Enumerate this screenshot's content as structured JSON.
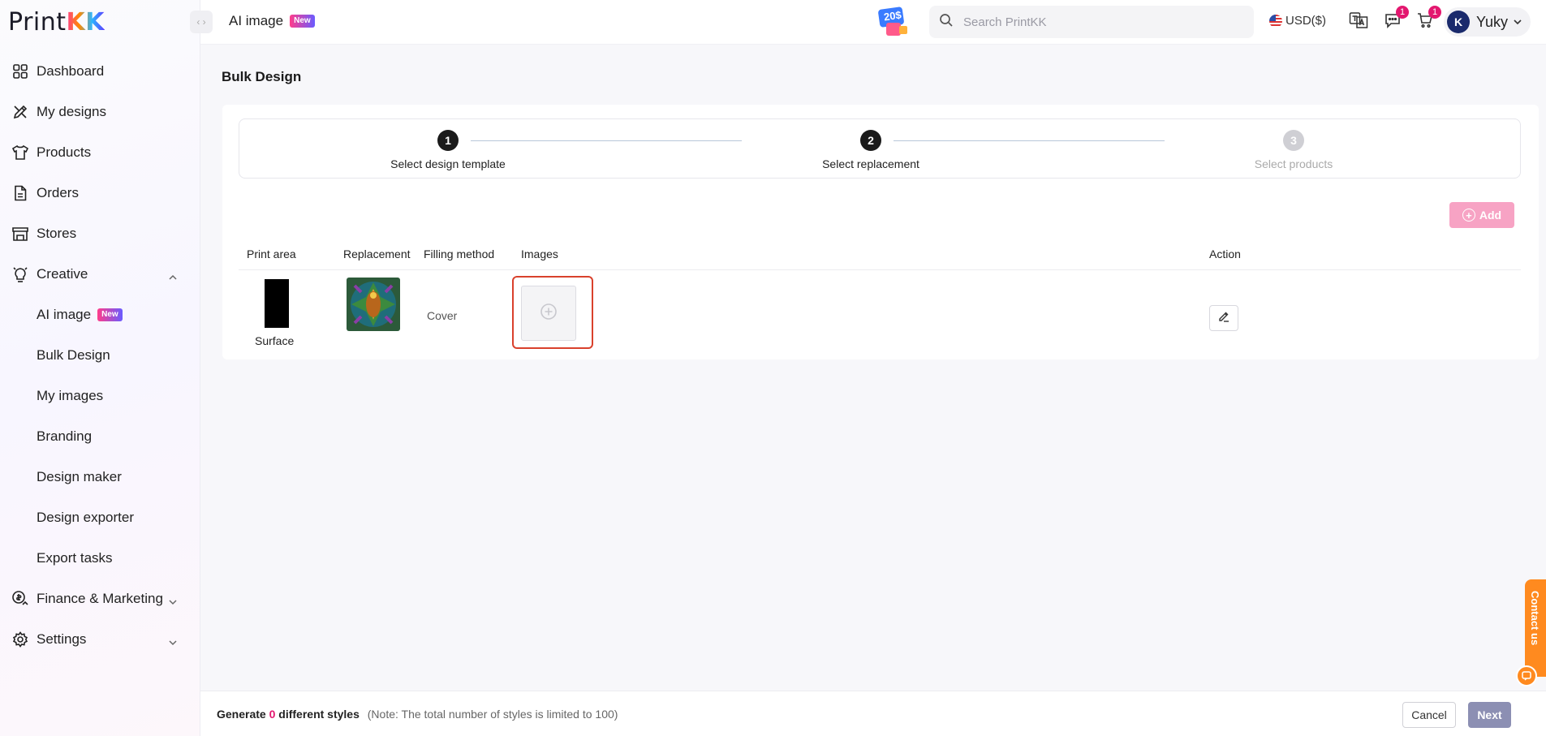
{
  "brand": {
    "name_part1": "Print",
    "name_part2": "KK"
  },
  "topbar": {
    "page_tab": "AI image",
    "new_badge": "New",
    "promo_text": "20$",
    "search_placeholder": "Search PrintKK",
    "currency": "USD($)",
    "messages_count": "1",
    "cart_count": "1",
    "user_initial": "K",
    "user_name": "Yuky"
  },
  "sidebar": {
    "items": [
      {
        "label": "Dashboard",
        "icon": "dashboard-icon"
      },
      {
        "label": "My designs",
        "icon": "designs-icon"
      },
      {
        "label": "Products",
        "icon": "tshirt-icon"
      },
      {
        "label": "Orders",
        "icon": "document-icon"
      },
      {
        "label": "Stores",
        "icon": "store-icon"
      },
      {
        "label": "Creative",
        "icon": "bulb-icon"
      }
    ],
    "creative_sub": [
      {
        "label": "AI image",
        "badge": "New"
      },
      {
        "label": "Bulk Design"
      },
      {
        "label": "My images"
      },
      {
        "label": "Branding"
      },
      {
        "label": "Design maker"
      },
      {
        "label": "Design exporter"
      },
      {
        "label": "Export tasks"
      }
    ],
    "bottom": [
      {
        "label": "Finance & Marketing",
        "icon": "finance-icon"
      },
      {
        "label": "Settings",
        "icon": "gear-icon"
      }
    ]
  },
  "main": {
    "title": "Bulk Design",
    "steps": [
      {
        "num": "1",
        "label": "Select design template"
      },
      {
        "num": "2",
        "label": "Select replacement"
      },
      {
        "num": "3",
        "label": "Select products"
      }
    ],
    "add_label": "Add",
    "table": {
      "headers": [
        "Print area",
        "Replacement",
        "Filling method",
        "Images",
        "Action"
      ],
      "rows": [
        {
          "print_area": "Surface",
          "filling_method": "Cover"
        }
      ]
    }
  },
  "footer": {
    "generate_prefix": "Generate",
    "count": "0",
    "generate_suffix": "different styles",
    "note": "(Note: The total number of styles is limited to 100)",
    "cancel": "Cancel",
    "next": "Next"
  },
  "contact": {
    "label": "Contact us"
  },
  "colors": {
    "accent": "#e3176f",
    "next_disabled": "#8c8fb3",
    "add_disabled": "#f7a3c4",
    "highlight": "#d9412c",
    "contact": "#ff8a1f"
  }
}
